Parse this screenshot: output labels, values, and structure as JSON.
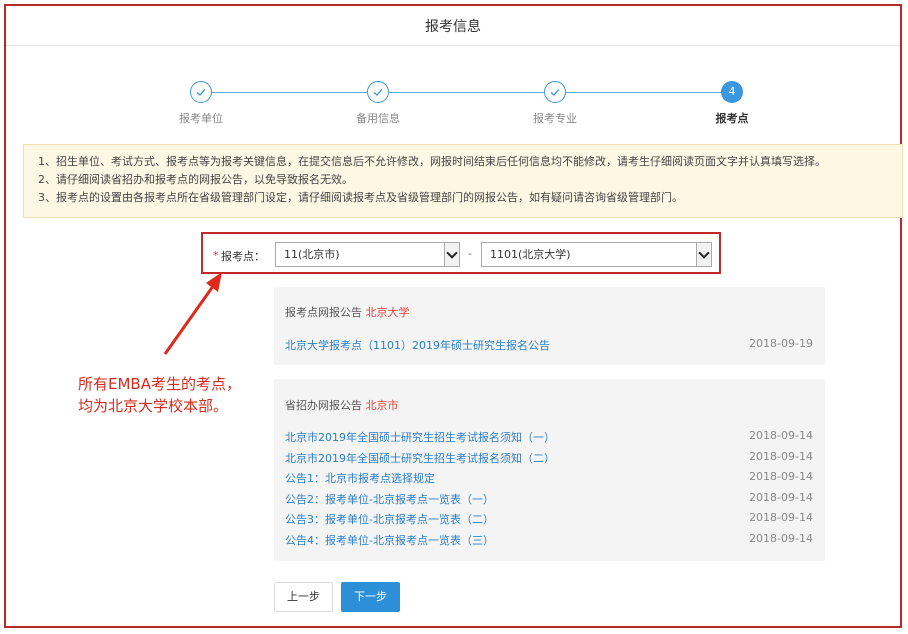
{
  "header": {
    "title": "报考信息"
  },
  "steps": [
    {
      "label": "报考单位",
      "icon": "check-icon",
      "state": "done"
    },
    {
      "label": "备用信息",
      "icon": "check-icon",
      "state": "done"
    },
    {
      "label": "报考专业",
      "icon": "check-icon",
      "state": "done"
    },
    {
      "label": "报考点",
      "number": "4",
      "state": "active"
    }
  ],
  "notice": {
    "lines": [
      "1、招生单位、考试方式、报考点等为报考关键信息，在提交信息后不允许修改，网报时间结束后任何信息均不能修改，请考生仔细阅读页面文字并认真填写选择。",
      "2、请仔细阅读省招办和报考点的网报公告，以免导致报名无效。",
      "3、报考点的设置由各报考点所在省级管理部门设定，请仔细阅读报考点及省级管理部门的网报公告，如有疑问请咨询省级管理部门。"
    ]
  },
  "form": {
    "required_mark": "*",
    "label": "报考点：",
    "province_value": "11(北京市)",
    "separator": "-",
    "site_value": "1101(北京大学)"
  },
  "site_panel": {
    "title_prefix": "报考点网报公告",
    "title_highlight": "北京大学",
    "items": [
      {
        "text": "北京大学报考点（1101）2019年硕士研究生报名公告",
        "date": "2018-09-19"
      }
    ]
  },
  "province_panel": {
    "title_prefix": "省招办网报公告",
    "title_highlight": "北京市",
    "items": [
      {
        "text": "北京市2019年全国硕士研究生招生考试报名须知（一）",
        "date": "2018-09-14"
      },
      {
        "text": "北京市2019年全国硕士研究生招生考试报名须知（二）",
        "date": "2018-09-14"
      },
      {
        "text": "公告1：北京市报考点选择规定",
        "date": "2018-09-14"
      },
      {
        "text": "公告2：报考单位-北京报考点一览表（一）",
        "date": "2018-09-14"
      },
      {
        "text": "公告3：报考单位-北京报考点一览表（二）",
        "date": "2018-09-14"
      },
      {
        "text": "公告4：报考单位-北京报考点一览表（三）",
        "date": "2018-09-14"
      }
    ]
  },
  "annotation": {
    "line1": "所有EMBA考生的考点，",
    "line2": "均为北京大学校本部。",
    "color": "#d62c1e"
  },
  "buttons": {
    "prev": "上一步",
    "next": "下一步"
  },
  "colors": {
    "accent": "#2e8fd9",
    "link": "#2b7fc9",
    "highlight": "#e0453a",
    "frame": "#b52a2a"
  }
}
